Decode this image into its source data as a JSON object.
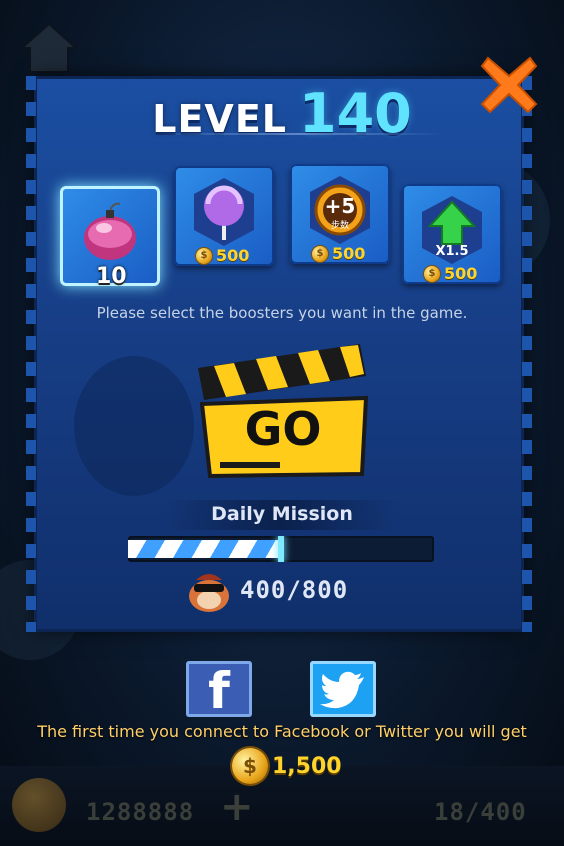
{
  "level": {
    "label": "LEVEL",
    "number": "140"
  },
  "boosters": [
    {
      "name": "bomb",
      "count": "10",
      "selected": true
    },
    {
      "name": "lollipop",
      "price": "500"
    },
    {
      "name": "plus-moves",
      "icon_text": "+5",
      "sub_text": "步数",
      "price": "500"
    },
    {
      "name": "multiplier",
      "icon_text": "X1.5",
      "price": "500"
    }
  ],
  "select_hint": "Please select the boosters you want in the game.",
  "go_label": "GO",
  "daily_mission": {
    "title": "Daily Mission",
    "progress_text": "400/800",
    "progress": 0.5
  },
  "social": {
    "facebook_glyph": "f",
    "reward_text": "The first time you connect to Facebook or Twitter you will get",
    "reward_amount": "1,500"
  },
  "background": {
    "coins": "1288888",
    "stars": "18/400"
  },
  "colors": {
    "level_number": "#5fe3ff",
    "coin_text": "#ffd42a",
    "panel": "#1b4fa3",
    "close": "#ff7a1a"
  }
}
